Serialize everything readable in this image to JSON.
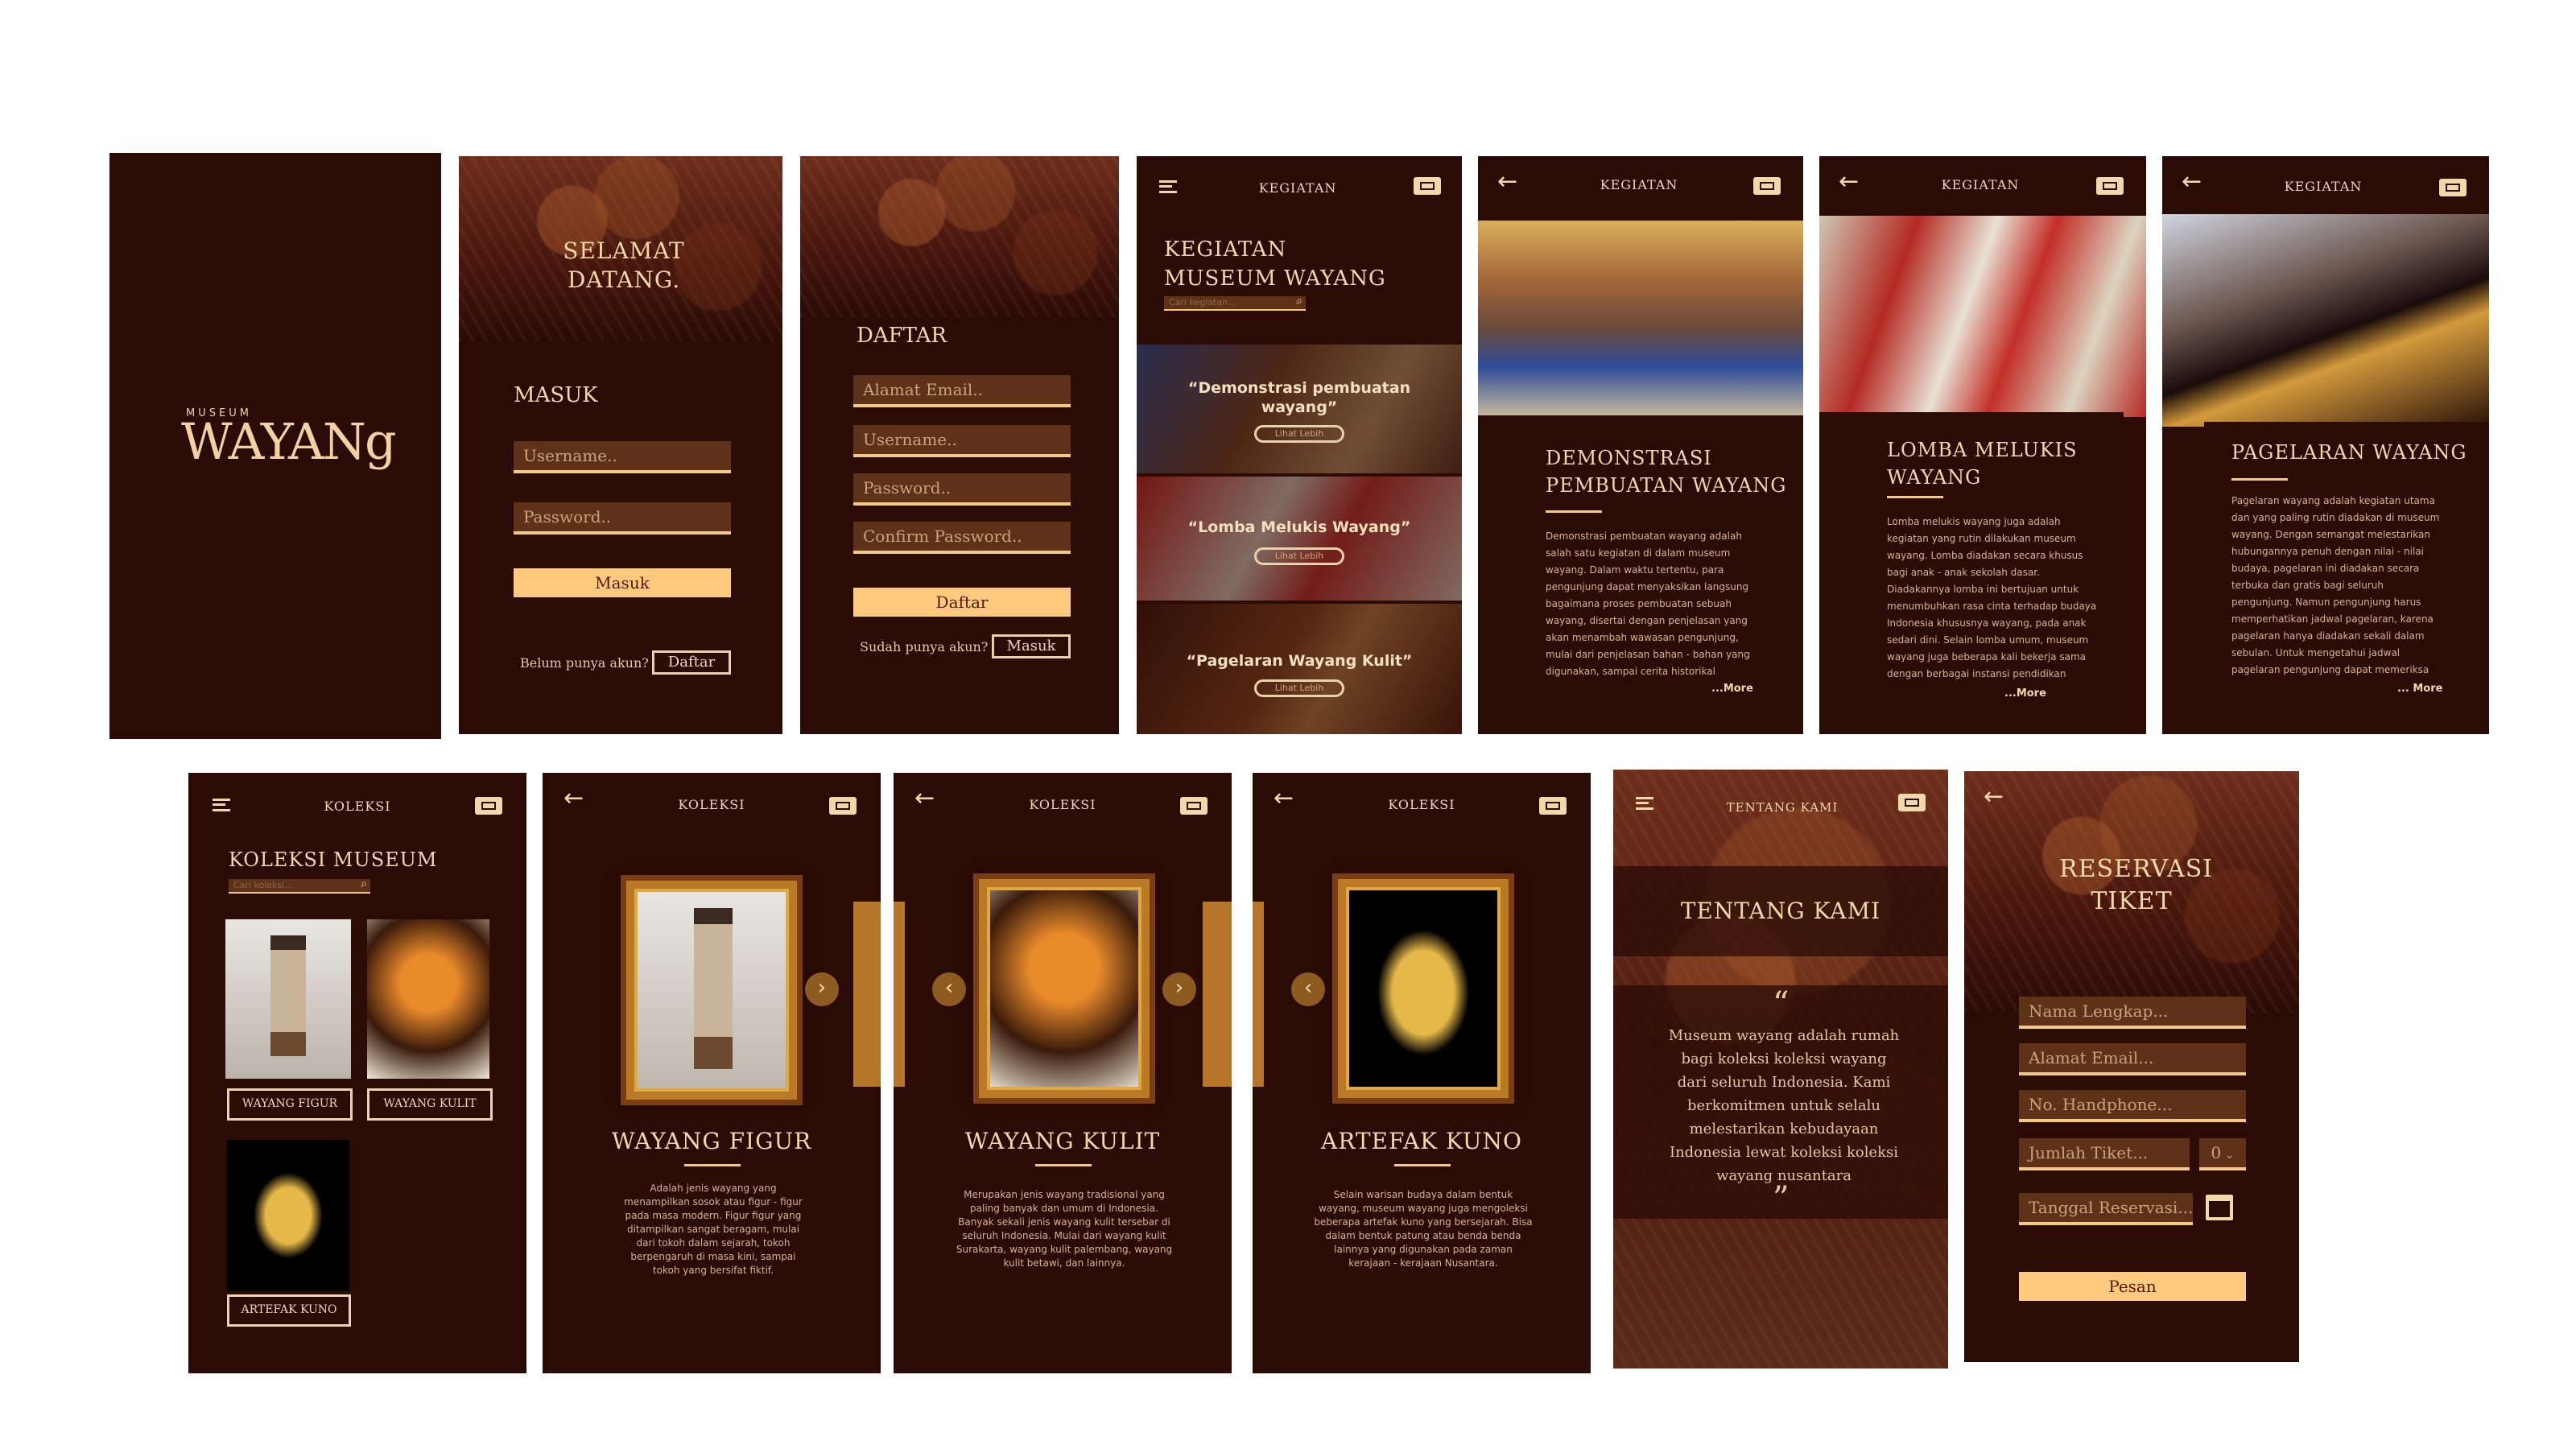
{
  "splash": {
    "logo_small": "MUSEUM",
    "logo_big": "WAYANg"
  },
  "login": {
    "title": "SELAMAT DATANG.",
    "section": "MASUK",
    "username": "Username..",
    "password": "Password..",
    "submit": "Masuk",
    "no_account": "Belum punya akun?",
    "register": "Daftar"
  },
  "register": {
    "title": "DAFTAR",
    "email": "Alamat Email..",
    "username": "Username..",
    "password": "Password..",
    "confirm": "Confirm Password..",
    "submit": "Daftar",
    "has_account": "Sudah punya akun?",
    "login": "Masuk"
  },
  "activities": {
    "header": "KEGIATAN",
    "title": "KEGIATAN MUSEUM WAYANG",
    "search_placeholder": "Cari kegiatan...",
    "items": [
      {
        "title": "“Demonstrasi pembuatan wayang”",
        "cta": "Lihat Lebih"
      },
      {
        "title": "“Lomba Melukis Wayang”",
        "cta": "Lihat Lebih"
      },
      {
        "title": "“Pagelaran Wayang Kulit”",
        "cta": "Lihat Lebih"
      }
    ]
  },
  "activity_demo": {
    "header": "KEGIATAN",
    "title": "DEMONSTRASI PEMBUATAN WAYANG",
    "body": "Demonstrasi pembuatan wayang adalah salah satu kegiatan di dalam museum wayang. Dalam waktu tertentu, para pengunjung dapat menyaksikan langsung bagaimana proses pembuatan sebuah wayang, disertai dengan penjelasan yang akan menambah wawasan pengunjung, mulai dari penjelasan bahan - bahan yang digunakan, sampai cerita historikal",
    "more": "...More"
  },
  "activity_paint": {
    "header": "KEGIATAN",
    "title": "LOMBA MELUKIS WAYANG",
    "body": "Lomba melukis wayang juga adalah kegiatan yang rutin dilakukan museum wayang. Lomba diadakan secara khusus bagi anak - anak sekolah dasar. Diadakannya lomba ini bertujuan untuk menumbuhkan rasa cinta terhadap budaya Indonesia khususnya wayang, pada anak sedari dini. Selain lomba umum, museum wayang juga beberapa kali bekerja sama dengan berbagai instansi pendidikan",
    "more": "...More"
  },
  "activity_show": {
    "header": "KEGIATAN",
    "title": "PAGELARAN WAYANG",
    "body": "Pagelaran wayang adalah kegiatan utama dan yang paling rutin diadakan di museum wayang. Dengan semangat melestarikan hubungannya penuh dengan nilai - nilai budaya, pagelaran ini diadakan secara terbuka dan gratis bagi seluruh pengunjung. Namun pengunjung harus memperhatikan jadwal pagelaran, karena pagelaran hanya diadakan sekali dalam sebulan. Untuk mengetahui jadwal pagelaran pengunjung dapat memeriksa",
    "more": "... More"
  },
  "collection": {
    "header": "KOLEKSI",
    "title": "KOLEKSI MUSEUM",
    "search_placeholder": "Cari koleksi...",
    "cards": [
      {
        "label": "WAYANG FIGUR"
      },
      {
        "label": "WAYANG KULIT"
      },
      {
        "label": "ARTEFAK KUNO"
      }
    ]
  },
  "figur": {
    "header": "KOLEKSI",
    "title": "WAYANG FIGUR",
    "body": "Adalah jenis wayang yang menampilkan sosok atau figur - figur pada masa modern. Figur figur yang ditampilkan sangat beragam, mulai dari tokoh dalam sejarah, tokoh berpengaruh di masa kini, sampai tokoh yang bersifat fiktif."
  },
  "kulit": {
    "header": "KOLEKSI",
    "title": "WAYANG KULIT",
    "body": "Merupakan jenis wayang tradisional yang paling banyak dan umum di Indonesia. Banyak sekali jenis wayang kulit tersebar di seluruh Indonesia. Mulai dari wayang kulit Surakarta, wayang kulit palembang, wayang kulit betawi, dan lainnya."
  },
  "artefak": {
    "header": "KOLEKSI",
    "title": "ARTEFAK KUNO",
    "body": "Selain warisan budaya dalam bentuk wayang, museum wayang juga mengoleksi beberapa artefak kuno yang bersejarah. Bisa dalam bentuk patung atau benda benda lainnya yang digunakan pada zaman kerajaan - kerajaan Nusantara."
  },
  "about": {
    "header": "TENTANG KAMI",
    "title": "TENTANG KAMI",
    "quote_open": "“",
    "quote_close": "”",
    "body": "Museum wayang adalah rumah bagi koleksi koleksi wayang dari seluruh Indonesia. Kami berkomitmen untuk selalu melestarikan kebudayaan Indonesia lewat koleksi koleksi wayang nusantara"
  },
  "reservation": {
    "title": "RESERVASI TIKET",
    "name": "Nama Lengkap...",
    "email": "Alamat Email...",
    "phone": "No. Handphone...",
    "tickets": "Jumlah Tiket...",
    "ticket_count": "0",
    "date": "Tanggal Reservasi...",
    "submit": "Pesan"
  },
  "icons": {
    "menu": "menu-icon",
    "ticket": "ticket-icon",
    "back": "back-arrow-icon",
    "search": "search-icon",
    "next": "chevron-right-icon",
    "prev": "chevron-left-icon",
    "calendar": "calendar-icon",
    "quote": "quote-icon"
  },
  "colors": {
    "background": "#2a0b06",
    "accent": "#f3d49c",
    "button": "#ffc97e",
    "frame": "#ba7a26"
  }
}
